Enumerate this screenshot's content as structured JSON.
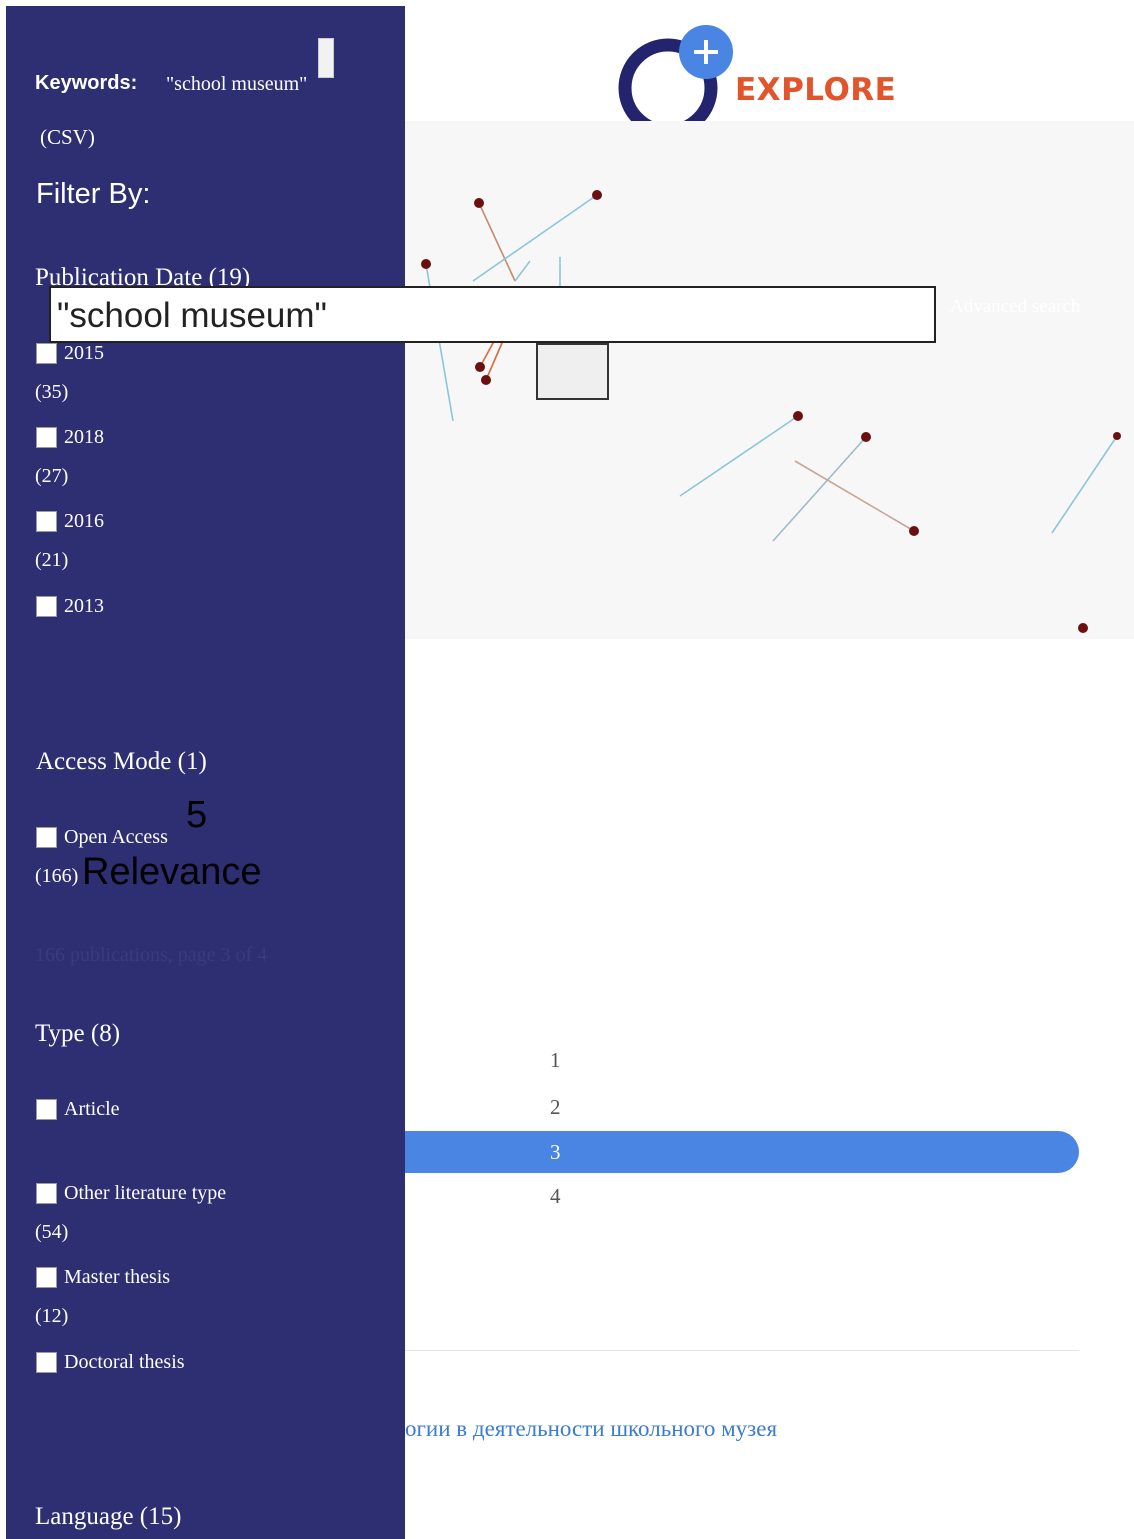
{
  "colors": {
    "sidebar_bg": "#2e2e72",
    "accent_blue": "#4a85e3",
    "logo_orange": "#e2542b",
    "logo_navy": "#24246e",
    "link_blue": "#3a7bd5"
  },
  "brand": {
    "logo_text": "EXPLORE",
    "logo_icon": "plus-icon"
  },
  "hero": {
    "advanced_search_label": "Advanced search"
  },
  "search": {
    "query": "\"school museum\""
  },
  "sidebar": {
    "keywords_label": "Keywords:",
    "keywords_value": "\"school museum\"",
    "csv_label": "(CSV)",
    "filter_by": "Filter By:",
    "publication_date": {
      "title": "Publication Date (19)",
      "options": [
        {
          "label": "2015",
          "count": "(35)"
        },
        {
          "label": "2018",
          "count": "(27)"
        },
        {
          "label": "2016",
          "count": "(21)"
        },
        {
          "label": "2013",
          "count": ""
        }
      ]
    },
    "access_mode": {
      "title": "Access Mode (1)",
      "options": [
        {
          "label": "Open Access",
          "count": "(166)"
        }
      ]
    },
    "results_info": "166 publications, page    3 of 4",
    "type": {
      "title": "Type (8)",
      "options": [
        {
          "label": "Article",
          "count": ""
        },
        {
          "label": "Other literature type",
          "count": "(54)"
        },
        {
          "label": "Master thesis",
          "count": "(12)"
        },
        {
          "label": "Doctoral thesis",
          "count": ""
        }
      ]
    },
    "language": {
      "title": "Language (15)"
    }
  },
  "results": {
    "page_size_value": "5",
    "sort_value": "Relevance",
    "pagination": [
      "1",
      "2",
      "3",
      "4"
    ],
    "current_page": 3,
    "first_result_title": "огии в деятельности школьного музея"
  }
}
